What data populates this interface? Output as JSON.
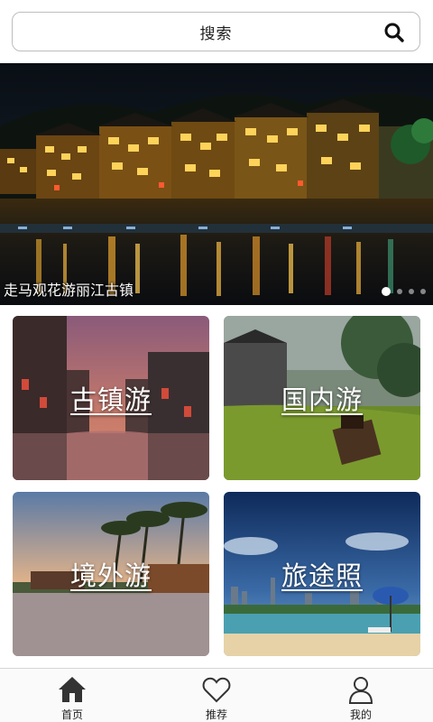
{
  "search": {
    "label": "搜索",
    "icon": "search-icon"
  },
  "banner": {
    "caption": "走马观花游丽江古镇",
    "page_count": 4,
    "active_page": 1
  },
  "tiles": [
    {
      "label": "古镇游",
      "theme": "ancient-town-canal"
    },
    {
      "label": "国内游",
      "theme": "green-lake-boat"
    },
    {
      "label": "境外游",
      "theme": "palm-beach-sunset"
    },
    {
      "label": "旅途照",
      "theme": "city-skyline-beach"
    }
  ],
  "nav": {
    "items": [
      {
        "label": "首页",
        "icon": "home-icon",
        "active": true
      },
      {
        "label": "推荐",
        "icon": "heart-icon",
        "active": false
      },
      {
        "label": "我的",
        "icon": "user-icon",
        "active": false
      }
    ]
  },
  "colors": {
    "accent": "#333333",
    "border": "#bdbdbd"
  }
}
